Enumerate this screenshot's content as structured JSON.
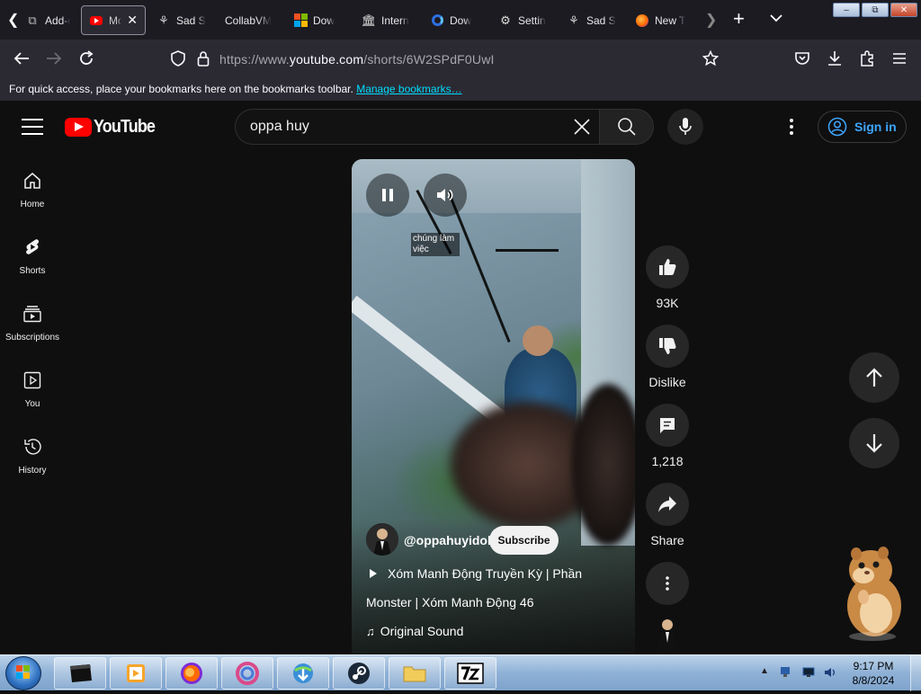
{
  "browser": {
    "tabs": [
      {
        "label": "Add-o",
        "icon": "puzzle-icon"
      },
      {
        "label": "Mo",
        "icon": "youtube-icon",
        "active": true
      },
      {
        "label": "Sad S",
        "icon": "wolf-icon"
      },
      {
        "label": "CollabVM",
        "icon": "none"
      },
      {
        "label": "Dow",
        "icon": "microsoft-icon"
      },
      {
        "label": "Intern",
        "icon": "archive-icon"
      },
      {
        "label": "Dow",
        "icon": "edge-icon"
      },
      {
        "label": "Settin",
        "icon": "gear-icon"
      },
      {
        "label": "Sad S",
        "icon": "wolf-icon"
      },
      {
        "label": "New T",
        "icon": "firefox-icon"
      }
    ],
    "url": {
      "prefix": "https://www.",
      "domain": "youtube.com",
      "path": "/shorts/6W2SPdF0UwI"
    },
    "bookmarks_bar": {
      "text": "For quick access, place your bookmarks here on the bookmarks toolbar.",
      "link": "Manage bookmarks…"
    }
  },
  "youtube": {
    "logo_text": "YouTube",
    "search": {
      "value": "oppa huy"
    },
    "signin_label": "Sign in",
    "sidebar": [
      {
        "label": "Home",
        "icon": "home-icon"
      },
      {
        "label": "Shorts",
        "icon": "shorts-icon"
      },
      {
        "label": "Subscriptions",
        "icon": "subscriptions-icon"
      },
      {
        "label": "You",
        "icon": "you-icon"
      },
      {
        "label": "History",
        "icon": "history-icon"
      }
    ],
    "video": {
      "caption": "chúng làm việc",
      "channel": "@oppahuyidol",
      "subscribe_label": "Subscribe",
      "title_line1": "Xóm Manh Động Truyền Kỳ | Phần",
      "title_line2": "Monster | Xóm Manh Động 46",
      "sound": "Original Sound"
    },
    "actions": {
      "likes": "93K",
      "dislike_label": "Dislike",
      "comments": "1,218",
      "share_label": "Share"
    }
  },
  "taskbar": {
    "time": "9:17 PM",
    "date": "8/8/2024"
  }
}
